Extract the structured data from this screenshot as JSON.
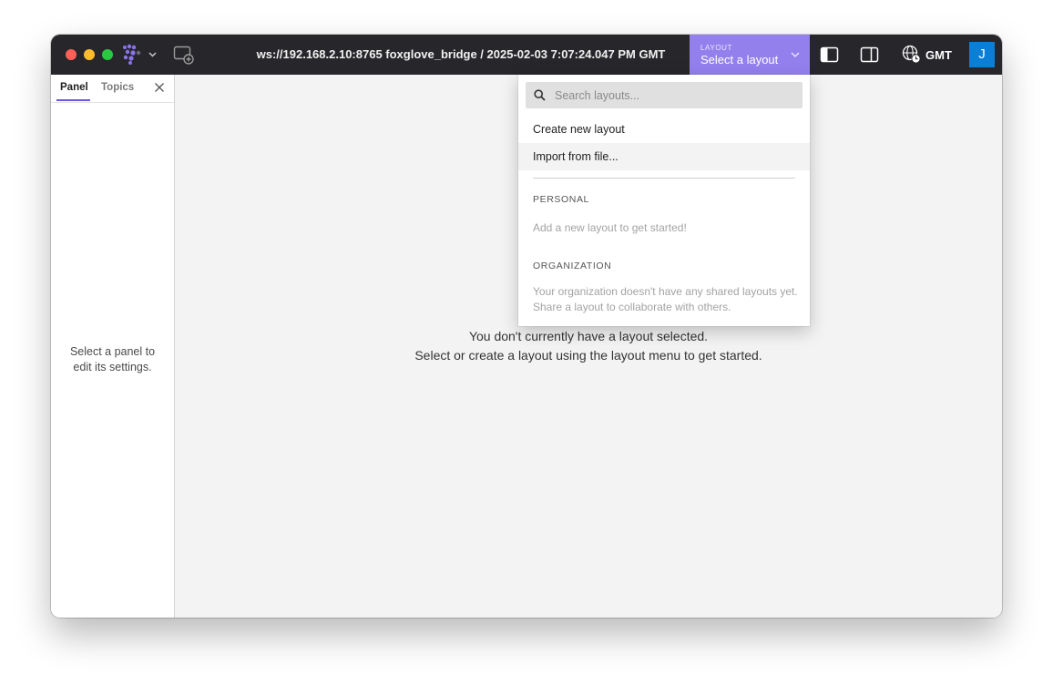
{
  "titlebar": {
    "connection_title": "ws://192.168.2.10:8765 foxglove_bridge / 2025-02-03 7:07:24.047 PM GMT",
    "layout_button": {
      "caption": "LAYOUT",
      "label": "Select a layout"
    },
    "timezone_label": "GMT",
    "avatar_initial": "J",
    "icons": {
      "logo": "foxglove-logo-icon",
      "add_panel": "add-panel-icon",
      "left_sidebar_toggle": "left-sidebar-toggle-icon",
      "right_sidebar_toggle": "right-sidebar-toggle-icon",
      "timezone": "globe-clock-icon"
    }
  },
  "sidebar": {
    "tabs": [
      {
        "label": "Panel",
        "active": true
      },
      {
        "label": "Topics",
        "active": false
      }
    ],
    "empty_message_line1": "Select a panel to",
    "empty_message_line2": "edit its settings."
  },
  "main": {
    "message_line1": "You don't currently have a layout selected.",
    "message_line2": "Select or create a layout using the layout menu to get started."
  },
  "layout_menu": {
    "search_placeholder": "Search layouts...",
    "items": [
      {
        "label": "Create new layout"
      },
      {
        "label": "Import from file..."
      }
    ],
    "personal": {
      "heading": "PERSONAL",
      "empty": "Add a new layout to get started!"
    },
    "organization": {
      "heading": "ORGANIZATION",
      "empty": "Your organization doesn't have any shared layouts yet. Share a layout to collaborate with others."
    }
  },
  "colors": {
    "titlebar_bg": "#27272b",
    "layout_button_bg": "#9480ed",
    "accent": "#6f55e2",
    "avatar_bg": "#0b7fd6"
  }
}
